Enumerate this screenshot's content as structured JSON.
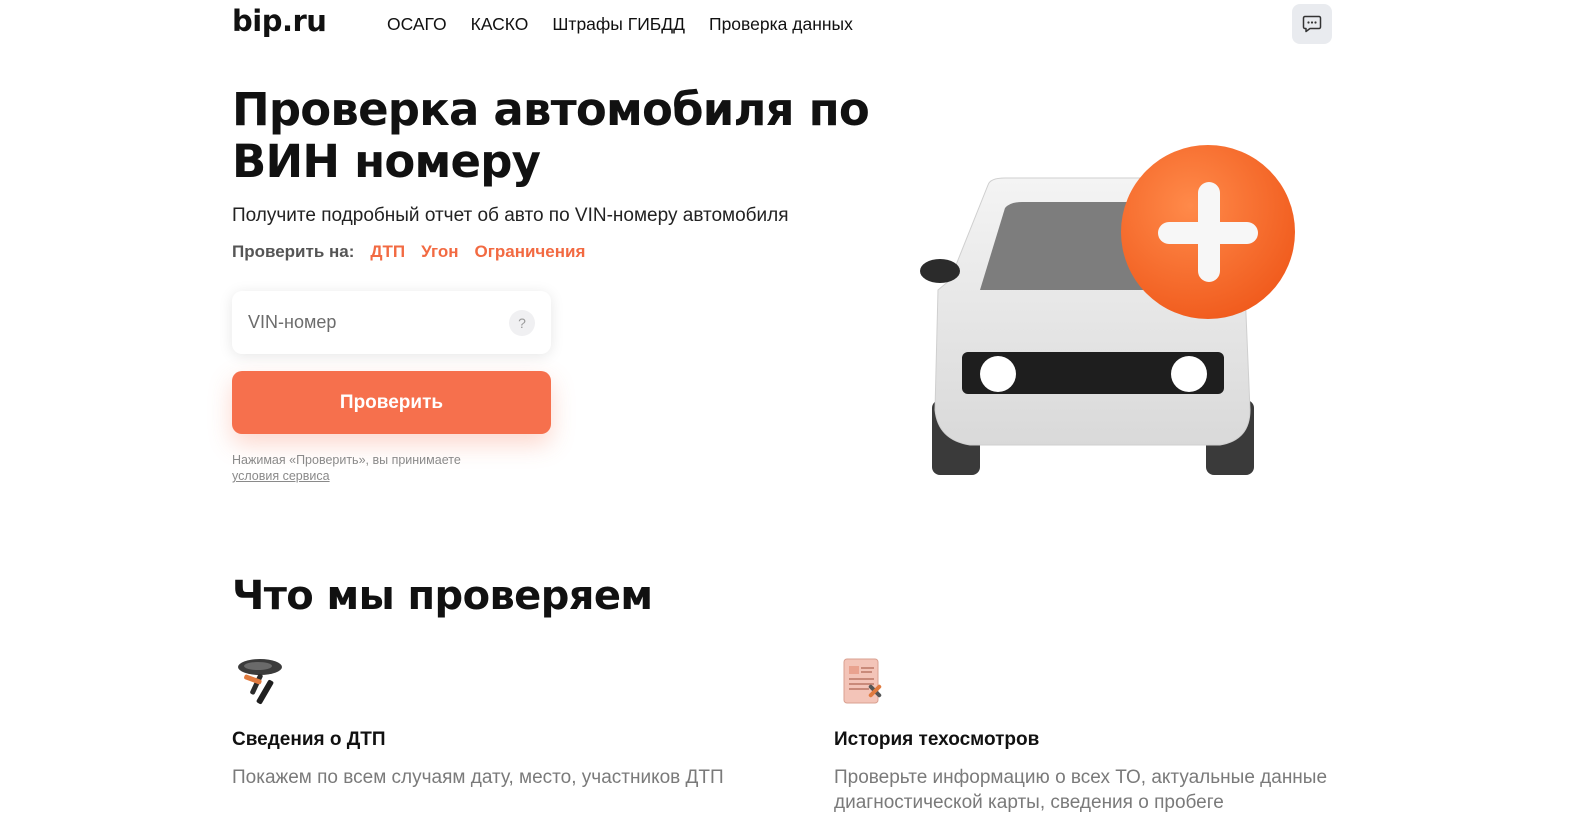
{
  "header": {
    "logo": "bip.ru",
    "nav": [
      "ОСАГО",
      "КАСКО",
      "Штрафы ГИБДД",
      "Проверка данных"
    ]
  },
  "hero": {
    "title": "Проверка автомобиля по ВИН номеру",
    "subtitle": "Получите подробный отчет об авто по VIN-номеру автомобиля",
    "check_label": "Проверить на:",
    "check_links": [
      "ДТП",
      "Угон",
      "Ограничения"
    ],
    "vin_placeholder": "VIN-номер",
    "help_glyph": "?",
    "submit_label": "Проверить",
    "disclaimer_text": "Нажимая «Проверить», вы принимаете",
    "disclaimer_link": "условия сервиса"
  },
  "section": {
    "title": "Что мы проверяем",
    "features": [
      {
        "icon": "crash-icon",
        "title": "Сведения о ДТП",
        "desc": "Покажем по всем случаям дату, место, участников ДТП"
      },
      {
        "icon": "inspection-card-icon",
        "title": "История техосмотров",
        "desc": "Проверьте информацию о всех ТО, актуальные данные диагностической карты, сведения о пробеге"
      }
    ]
  },
  "colors": {
    "accent": "#f6704d",
    "link": "#f26a42",
    "chat_bg": "#e9ebef"
  }
}
